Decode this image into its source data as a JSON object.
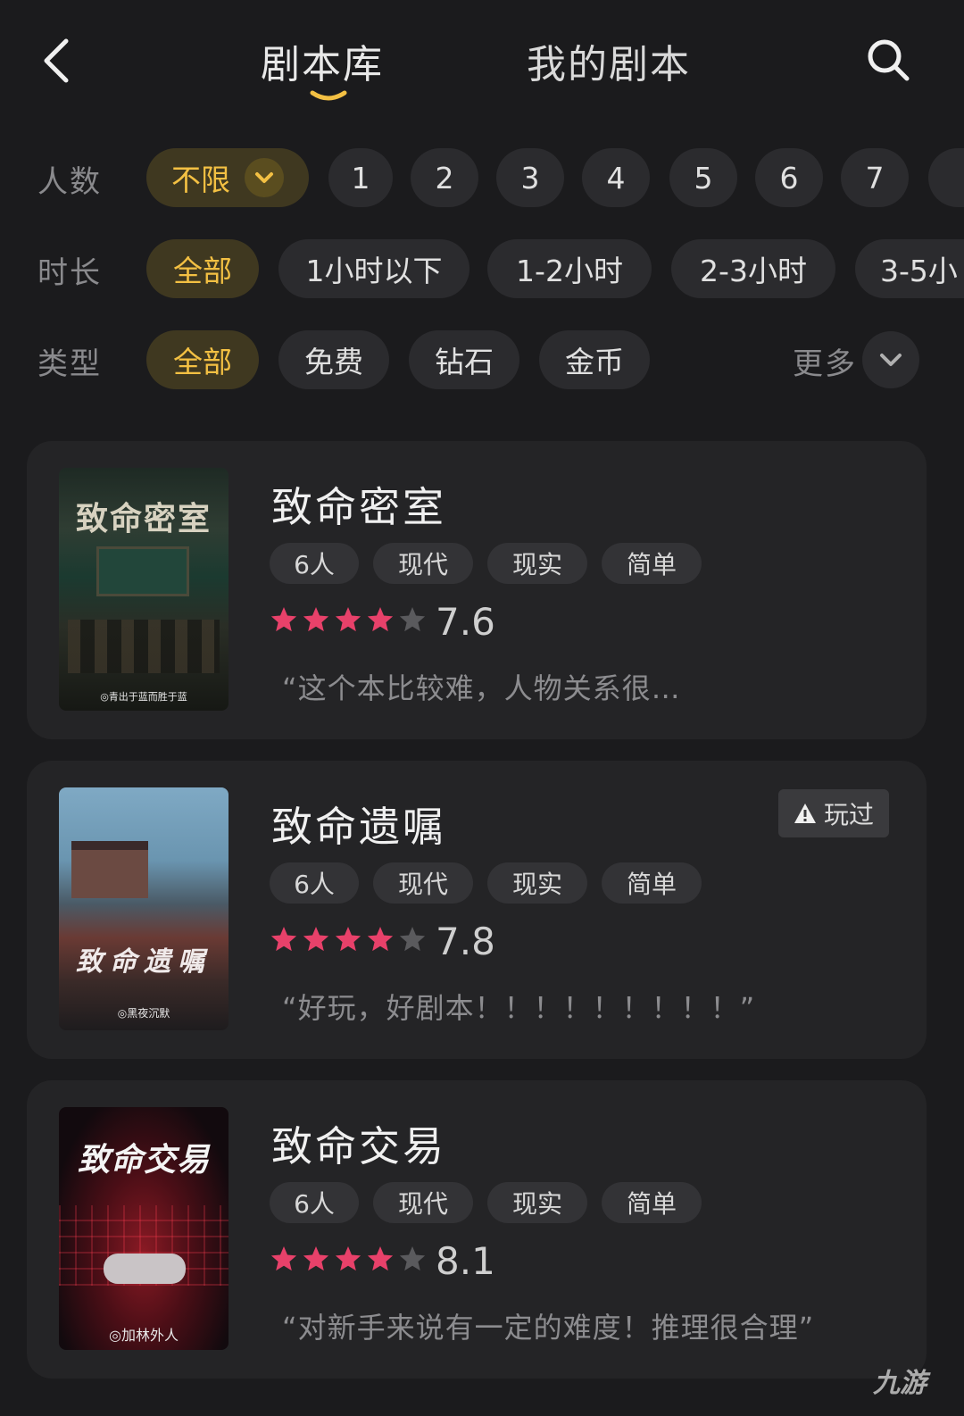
{
  "nav": {
    "tab_library": "剧本库",
    "tab_mine": "我的剧本",
    "back_icon": "chevron-left-icon",
    "search_icon": "search-icon",
    "accent": "#f3c043"
  },
  "filters": {
    "people": {
      "label": "人数",
      "options": [
        "不限",
        "1",
        "2",
        "3",
        "4",
        "5",
        "6",
        "7"
      ]
    },
    "duration": {
      "label": "时长",
      "options": [
        "全部",
        "1小时以下",
        "1-2小时",
        "2-3小时",
        "3-5小"
      ]
    },
    "type": {
      "label": "类型",
      "options": [
        "全部",
        "免费",
        "钻石",
        "金币"
      ],
      "more_label": "更多"
    }
  },
  "scripts": [
    {
      "title": "致命密室",
      "cover_title": "致命密室",
      "cover_author": "◎青出于蓝而胜于蓝",
      "tags": [
        "6人",
        "现代",
        "现实",
        "简单"
      ],
      "rating": "7.6",
      "stars": 4,
      "review": "“这个本比较难，人物关系很…"
    },
    {
      "title": "致命遗嘱",
      "cover_title": "致命遗嘱",
      "cover_author": "◎黑夜沉默",
      "tags": [
        "6人",
        "现代",
        "现实",
        "简单"
      ],
      "rating": "7.8",
      "stars": 4,
      "review": "“好玩，好剧本！！！！！！！！！”",
      "badge": "玩过"
    },
    {
      "title": "致命交易",
      "cover_title": "致命交易",
      "cover_author": "◎加林外人",
      "tags": [
        "6人",
        "现代",
        "现实",
        "简单"
      ],
      "rating": "8.1",
      "stars": 4,
      "review": "“对新手来说有一定的难度！推理很合理”"
    }
  ],
  "watermark": "九游",
  "colors": {
    "star_active": "#e8416a",
    "star_inactive": "#5a5a5d"
  }
}
